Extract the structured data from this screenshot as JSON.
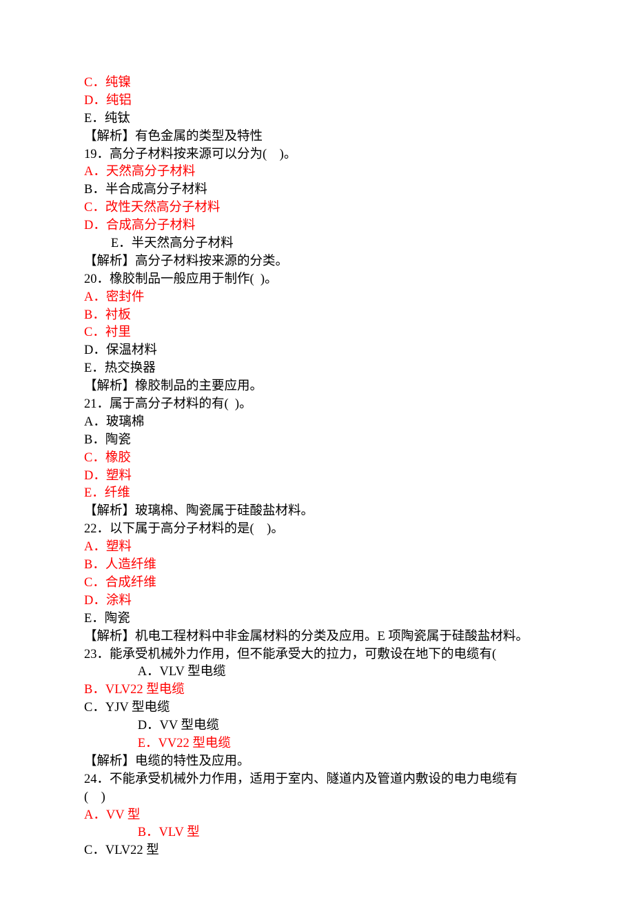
{
  "lines": [
    {
      "text": "C．纯镍",
      "class": "red"
    },
    {
      "text": "D．纯铝",
      "class": "red"
    },
    {
      "text": "E．纯钛",
      "class": ""
    },
    {
      "text": "【解析】有色金属的类型及特性",
      "class": ""
    },
    {
      "text": "19．高分子材料按来源可以分为(    )。",
      "class": ""
    },
    {
      "text": "A．天然高分子材料",
      "class": "red"
    },
    {
      "text": "B．半合成高分子材料",
      "class": ""
    },
    {
      "text": "C．改性天然高分子材料",
      "class": "red"
    },
    {
      "text": "D．合成高分子材料",
      "class": "red"
    },
    {
      "text": "E．半天然高分子材料",
      "class": "indent1"
    },
    {
      "text": "【解析】高分子材料按来源的分类。",
      "class": ""
    },
    {
      "text": "20．橡胶制品一般应用于制作(  )。",
      "class": ""
    },
    {
      "text": "A．密封件",
      "class": "red"
    },
    {
      "text": "B．衬板",
      "class": "red"
    },
    {
      "text": "C．衬里",
      "class": "red"
    },
    {
      "text": "D．保温材料",
      "class": ""
    },
    {
      "text": "E．热交换器",
      "class": ""
    },
    {
      "text": "【解析】橡胶制品的主要应用。",
      "class": ""
    },
    {
      "text": "21．属于高分子材料的有(  )。",
      "class": ""
    },
    {
      "text": "A．玻璃棉",
      "class": ""
    },
    {
      "text": "B．陶瓷",
      "class": ""
    },
    {
      "text": "C．橡胶",
      "class": "red"
    },
    {
      "text": "D．塑料",
      "class": "red"
    },
    {
      "text": "E．纤维",
      "class": "red"
    },
    {
      "text": "【解析】玻璃棉、陶瓷属于硅酸盐材料。",
      "class": ""
    },
    {
      "text": "22．以下属于高分子材料的是(    )。",
      "class": ""
    },
    {
      "text": "A．塑料",
      "class": "red"
    },
    {
      "text": "B．人造纤维",
      "class": "red"
    },
    {
      "text": "C．合成纤维",
      "class": "red"
    },
    {
      "text": "D．涂料",
      "class": "red"
    },
    {
      "text": "E．陶瓷",
      "class": ""
    },
    {
      "text": "【解析】机电工程材料中非金属材料的分类及应用。E 项陶瓷属于硅酸盐材料。",
      "class": ""
    },
    {
      "text": "23．能承受机械外力作用，但不能承受大的拉力，可敷设在地下的电缆有(",
      "class": ""
    },
    {
      "text": "A．VLV 型电缆",
      "class": "indent2"
    },
    {
      "text": "B．VLV22 型电缆",
      "class": "red"
    },
    {
      "text": "C．YJV 型电缆",
      "class": ""
    },
    {
      "text": "D．VV 型电缆",
      "class": "indent2"
    },
    {
      "text": "E．VV22 型电缆",
      "class": "red indent2"
    },
    {
      "text": "【解析】电缆的特性及应用。",
      "class": ""
    },
    {
      "text": "24．不能承受机械外力作用，适用于室内、隧道内及管道内敷设的电力电缆有",
      "class": ""
    },
    {
      "text": "(    )",
      "class": ""
    },
    {
      "text": "A．VV 型",
      "class": "red"
    },
    {
      "text": "B．VLV 型",
      "class": "red indent2"
    },
    {
      "text": "C．VLV22 型",
      "class": ""
    }
  ]
}
